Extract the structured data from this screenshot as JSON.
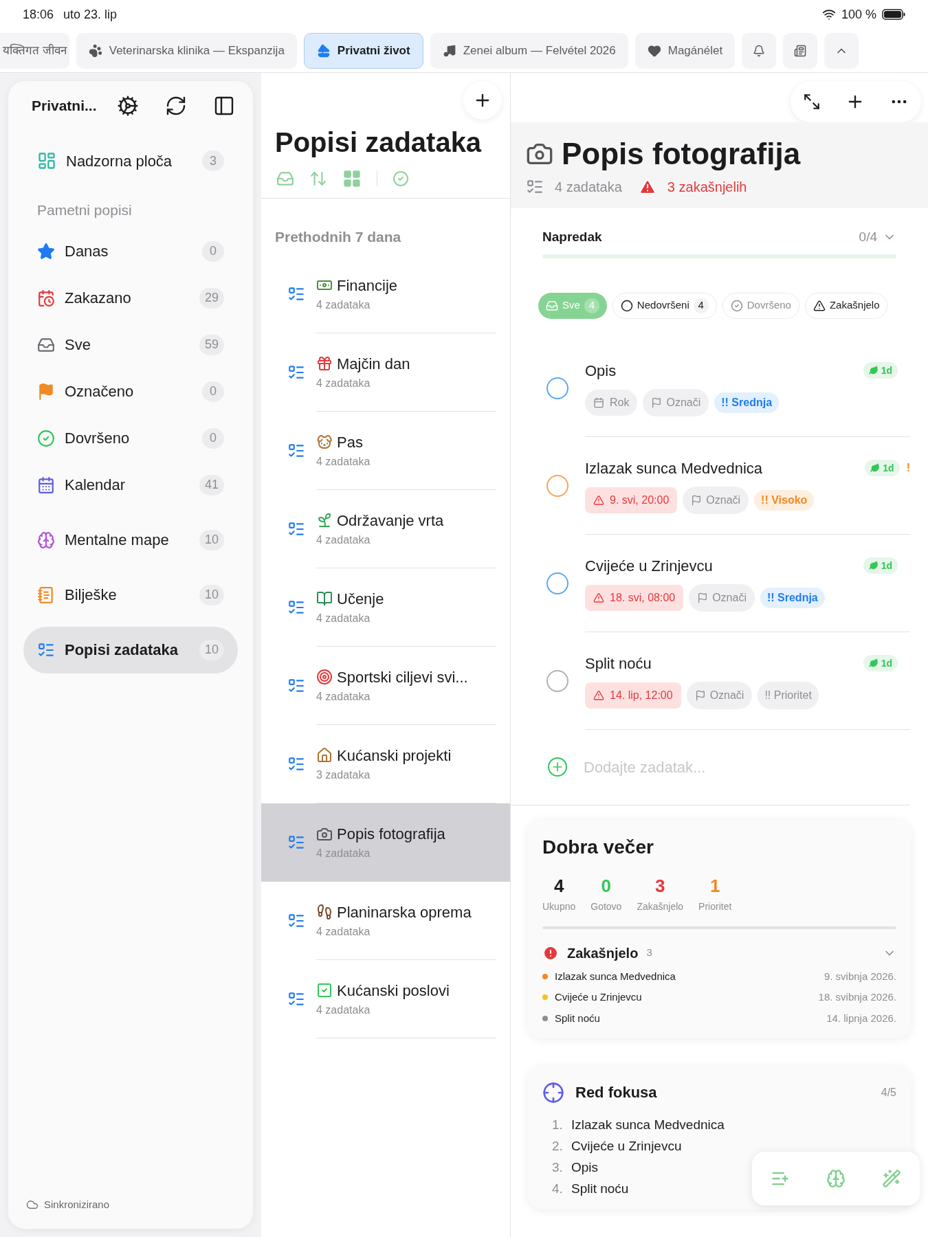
{
  "status_bar": {
    "time": "18:06",
    "date": "uto 23. lip",
    "battery": "100 %"
  },
  "tabs": [
    {
      "label": "यक्तिगत जीवन",
      "selected": false
    },
    {
      "label": "Veterinarska klinika — Ekspanzija",
      "selected": false
    },
    {
      "label": "Privatni život",
      "selected": true
    },
    {
      "label": "Zenei album — Felvétel 2026",
      "selected": false
    },
    {
      "label": "Magánélet",
      "selected": false
    }
  ],
  "sidebar": {
    "title": "Privatni...",
    "dashboard": {
      "label": "Nadzorna ploča",
      "count": "3"
    },
    "section": "Pametni popisi",
    "items": [
      {
        "label": "Danas",
        "count": "0",
        "selected": false
      },
      {
        "label": "Zakazano",
        "count": "29",
        "selected": false
      },
      {
        "label": "Sve",
        "count": "59",
        "selected": false
      },
      {
        "label": "Označeno",
        "count": "0",
        "selected": false
      },
      {
        "label": "Dovršeno",
        "count": "0",
        "selected": false
      },
      {
        "label": "Kalendar",
        "count": "41",
        "selected": false
      },
      {
        "label": "Mentalne mape",
        "count": "10",
        "selected": false
      },
      {
        "label": "Bilješke",
        "count": "10",
        "selected": false
      },
      {
        "label": "Popisi zadataka",
        "count": "10",
        "selected": true
      }
    ],
    "sync": "Sinkronizirano"
  },
  "lists_column": {
    "title": "Popisi zadataka",
    "group": "Prethodnih 7 dana",
    "lists": [
      {
        "name": "Financije",
        "count": "4 zadataka",
        "selected": false
      },
      {
        "name": "Majčin dan",
        "count": "4 zadataka",
        "selected": false
      },
      {
        "name": "Pas",
        "count": "4 zadataka",
        "selected": false
      },
      {
        "name": "Održavanje vrta",
        "count": "4 zadataka",
        "selected": false
      },
      {
        "name": "Učenje",
        "count": "4 zadataka",
        "selected": false
      },
      {
        "name": "Sportski ciljevi svi...",
        "count": "4 zadataka",
        "selected": false
      },
      {
        "name": "Kućanski projekti",
        "count": "3 zadataka",
        "selected": false
      },
      {
        "name": "Popis fotografija",
        "count": "4 zadataka",
        "selected": true
      },
      {
        "name": "Planinarska oprema",
        "count": "4 zadataka",
        "selected": false
      },
      {
        "name": "Kućanski poslovi",
        "count": "4 zadataka",
        "selected": false
      }
    ]
  },
  "detail": {
    "title": "Popis fotografija",
    "task_count": "4 zadataka",
    "overdue": "3 zakašnjelih",
    "progress": {
      "label": "Napredak",
      "reading": "0/4",
      "level": 0
    },
    "filters": [
      {
        "label": "Sve",
        "count": "4",
        "selected": true
      },
      {
        "label": "Nedovršeni",
        "count": "4",
        "selected": false
      },
      {
        "label": "Dovršeno",
        "selected": false
      },
      {
        "label": "Zakašnjelo",
        "selected": false
      }
    ],
    "tasks": [
      {
        "title": "Opis",
        "kind": "medium",
        "due": {
          "label": "Rok",
          "overdue": false
        },
        "flag": "Označi",
        "priority_label": "!! Srednja",
        "tag": "1d"
      },
      {
        "title": "Izlazak sunca Medvednica",
        "kind": "high",
        "due": {
          "label": "9. svi, 20:00",
          "overdue": true
        },
        "flag": "Označi",
        "priority_label": "!! Visoko",
        "tag": "1d",
        "alert_mark": "!"
      },
      {
        "title": "Cvijeće u Zrinjevcu",
        "kind": "medium",
        "due": {
          "label": "18. svi, 08:00",
          "overdue": true
        },
        "flag": "Označi",
        "priority_label": "!! Srednja",
        "tag": "1d"
      },
      {
        "title": "Split noću",
        "kind": "none",
        "due": {
          "label": "14. lip, 12:00",
          "overdue": true
        },
        "flag": "Označi",
        "priority_label": "!! Prioritet",
        "tag": "1d"
      }
    ],
    "add_placeholder": "Dodajte zadatak...",
    "summary": {
      "greeting": "Dobra večer",
      "stats": [
        {
          "value": "4",
          "label": "Ukupno",
          "color": "#1c1c1e"
        },
        {
          "value": "0",
          "label": "Gotovo",
          "color": "#34c759"
        },
        {
          "value": "3",
          "label": "Zakašnjelo",
          "color": "#e5383b"
        },
        {
          "value": "1",
          "label": "Prioritet",
          "color": "#f08a24"
        }
      ],
      "overdue_title": "Zakašnjelo",
      "overdue_count": "3",
      "overdue_items": [
        {
          "title": "Izlazak sunca Medvednica",
          "date": "9. svibnja 2026.",
          "color": "#f08a24"
        },
        {
          "title": "Cvijeće u Zrinjevcu",
          "date": "18. svibnja 2026.",
          "color": "#f5c518"
        },
        {
          "title": "Split noću",
          "date": "14. lipnja 2026.",
          "color": "#8e8e93"
        }
      ]
    },
    "focus": {
      "title": "Red fokusa",
      "reading": "4/5",
      "items": [
        {
          "number": "1.",
          "title": "Izlazak sunca Medvednica"
        },
        {
          "number": "2.",
          "title": "Cvijeće u Zrinjevcu"
        },
        {
          "number": "3.",
          "title": "Opis"
        },
        {
          "number": "4.",
          "title": "Split noću"
        }
      ]
    }
  }
}
